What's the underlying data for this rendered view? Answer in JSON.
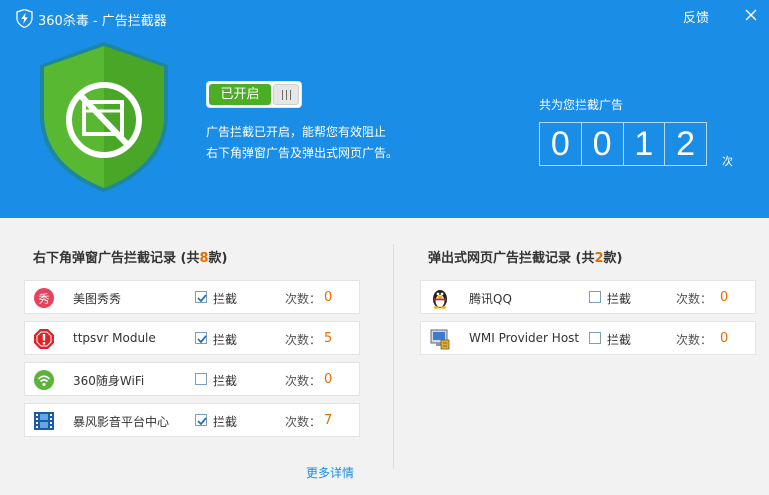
{
  "window": {
    "title": "360杀毒 - 广告拦截器",
    "feedback_label": "反馈"
  },
  "status": {
    "toggle_label": "已开启",
    "desc_line1": "广告拦截已开启，能帮您有效阻止",
    "desc_line2": "右下角弹窗广告及弹出式网页广告。"
  },
  "counter": {
    "label": "共为您拦截广告",
    "digits": [
      "0",
      "0",
      "1",
      "2"
    ],
    "unit": "次"
  },
  "left_panel": {
    "title_prefix": "右下角弹窗广告拦截记录 (共",
    "title_count": "8",
    "title_suffix": "款)",
    "items": [
      {
        "name": "美图秀秀",
        "block_label": "拦截",
        "blocked": true,
        "count_label": "次数：",
        "count": "0"
      },
      {
        "name": "ttpsvr Module",
        "block_label": "拦截",
        "blocked": true,
        "count_label": "次数：",
        "count": "5"
      },
      {
        "name": "360随身WiFi",
        "block_label": "拦截",
        "blocked": false,
        "count_label": "次数：",
        "count": "0"
      },
      {
        "name": "暴风影音平台中心",
        "block_label": "拦截",
        "blocked": true,
        "count_label": "次数：",
        "count": "7"
      }
    ],
    "more_label": "更多详情"
  },
  "right_panel": {
    "title_prefix": "弹出式网页广告拦截记录 (共",
    "title_count": "2",
    "title_suffix": "款)",
    "items": [
      {
        "name": "腾讯QQ",
        "block_label": "拦截",
        "blocked": false,
        "count_label": "次数：",
        "count": "0"
      },
      {
        "name": "WMI Provider Host",
        "block_label": "拦截",
        "blocked": false,
        "count_label": "次数：",
        "count": "0"
      }
    ]
  },
  "icons": {
    "app": "shield-lightning-icon",
    "close": "close-icon",
    "shield": "ad-block-shield-icon",
    "check": "checkmark-icon"
  },
  "colors": {
    "header_bg": "#1a8ee6",
    "toggle_on": "#4cae25",
    "count_accent": "#e76c00",
    "link": "#1a8ee6"
  }
}
